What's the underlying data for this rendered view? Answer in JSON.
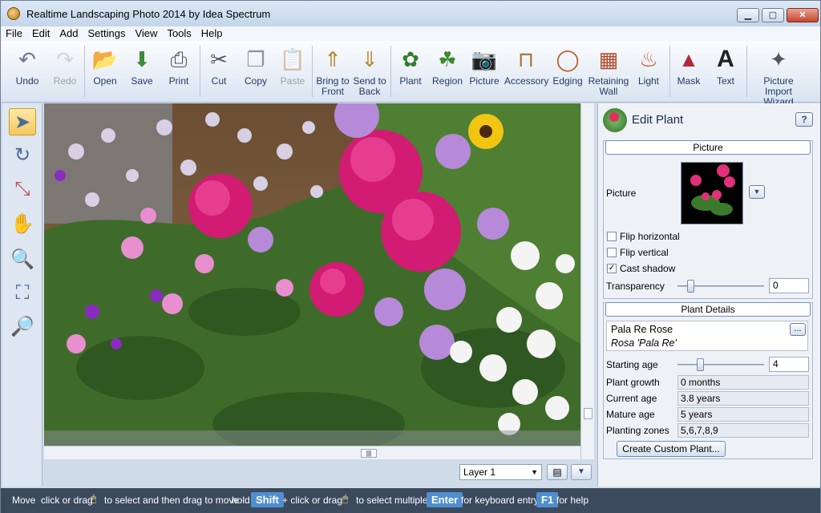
{
  "window": {
    "title": "Realtime Landscaping Photo 2014 by Idea Spectrum",
    "buttons": {
      "minimize": "▁",
      "maximize": "▢",
      "close": "✕"
    }
  },
  "menu": [
    "File",
    "Edit",
    "Add",
    "Settings",
    "View",
    "Tools",
    "Help"
  ],
  "toolbar": {
    "undo": "Undo",
    "redo": "Redo",
    "open": "Open",
    "save": "Save",
    "print": "Print",
    "cut": "Cut",
    "copy": "Copy",
    "paste": "Paste",
    "bring_to_front": [
      "Bring to",
      "Front"
    ],
    "send_to_back": [
      "Send to",
      "Back"
    ],
    "plant": "Plant",
    "region": "Region",
    "picture": "Picture",
    "accessory": "Accessory",
    "edging": "Edging",
    "retaining_wall": [
      "Retaining",
      "Wall"
    ],
    "light": "Light",
    "mask": "Mask",
    "text": "Text",
    "picture_import_wizard": [
      "Picture Import",
      "Wizard"
    ]
  },
  "layer": {
    "selected": "Layer 1"
  },
  "panel": {
    "title": "Edit Plant",
    "help": "?",
    "picture_group": {
      "title": "Picture",
      "picture_label": "Picture",
      "flip_horizontal": {
        "label": "Flip horizontal",
        "checked": false
      },
      "flip_vertical": {
        "label": "Flip vertical",
        "checked": false
      },
      "cast_shadow": {
        "label": "Cast shadow",
        "checked": true
      },
      "transparency_label": "Transparency",
      "transparency_value": "0"
    },
    "details_group": {
      "title": "Plant Details",
      "common_name": "Pala Re Rose",
      "botanical_name": "Rosa 'Pala Re'",
      "browse": "...",
      "starting_age_label": "Starting age",
      "starting_age_value": "4",
      "plant_growth_label": "Plant growth",
      "plant_growth_value": "0 months",
      "current_age_label": "Current age",
      "current_age_value": "3.8 years",
      "mature_age_label": "Mature age",
      "mature_age_value": "5 years",
      "planting_zones_label": "Planting zones",
      "planting_zones_value": "5,6,7,8,9",
      "create_custom": "Create Custom Plant..."
    }
  },
  "status": {
    "mode": "Move",
    "t1": "click or drag",
    "t2": "to select and then drag to move",
    "t3": "hold",
    "k1": "Shift",
    "t4": "+ click or drag",
    "t5": "to select multiple",
    "k2": "Enter",
    "t6": "for keyboard entry",
    "k3": "F1",
    "t7": "for help"
  }
}
